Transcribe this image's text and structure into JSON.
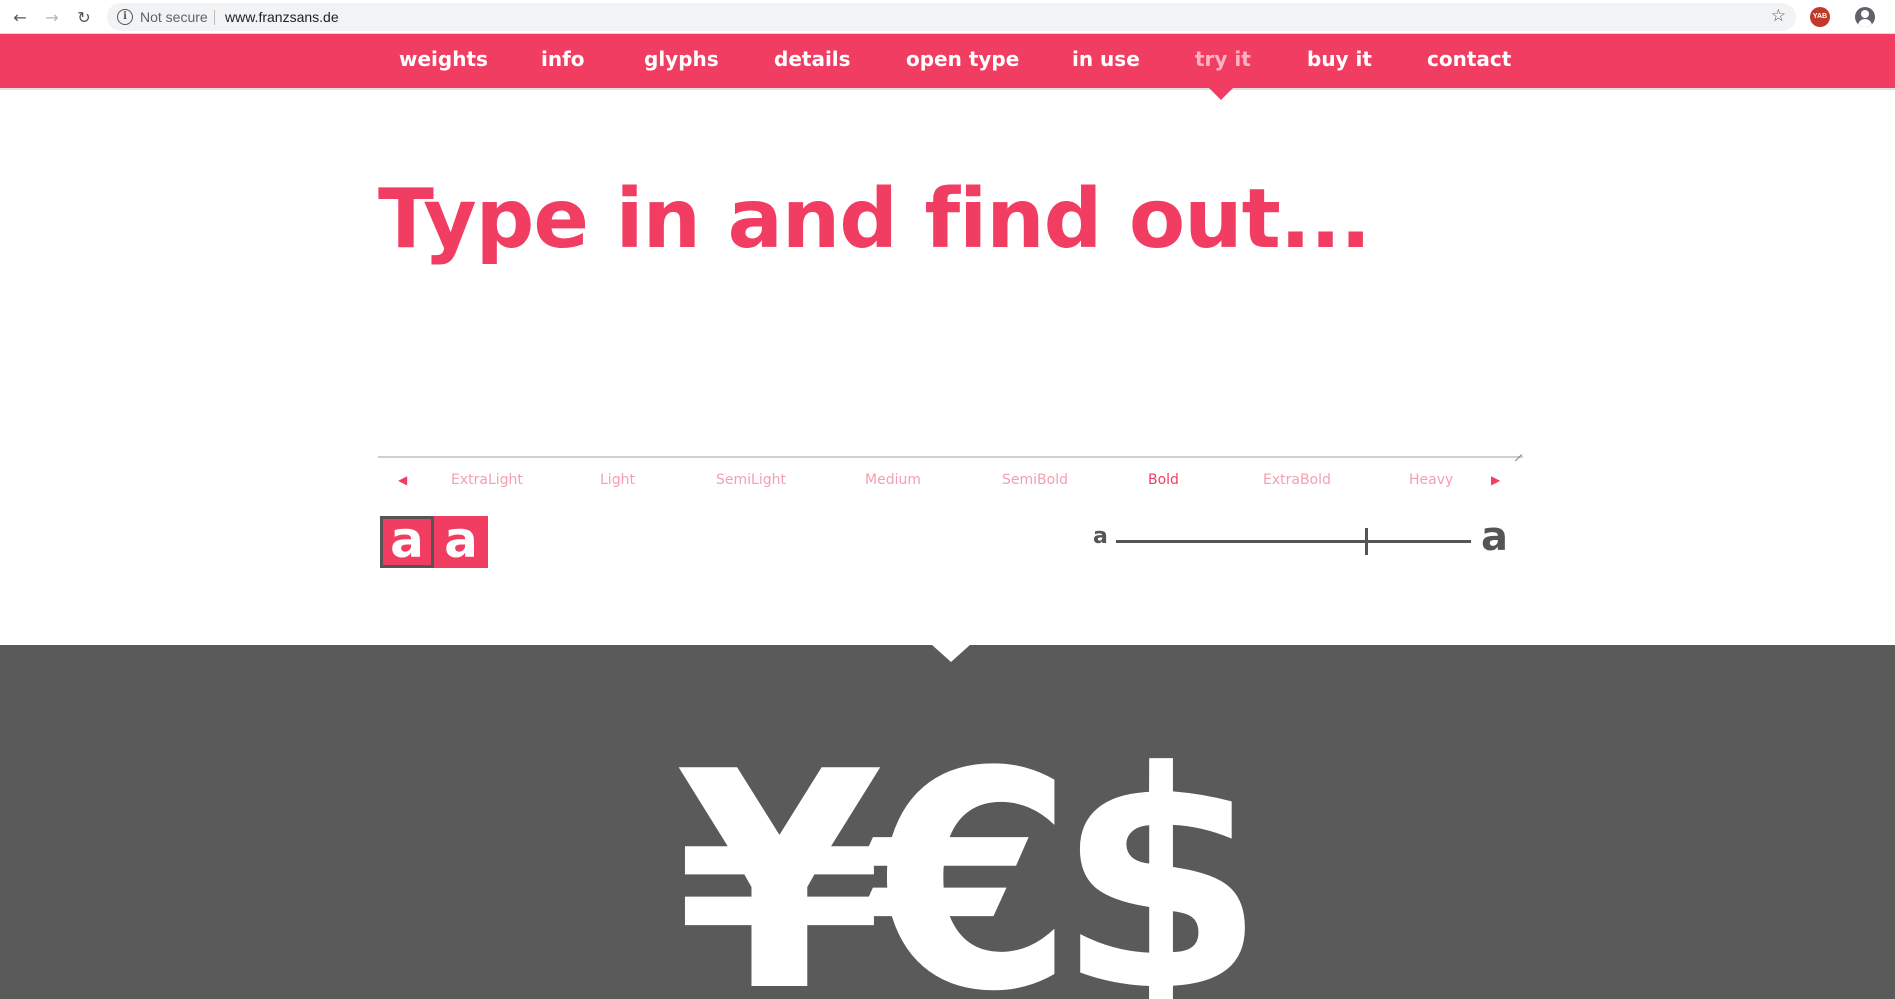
{
  "browser": {
    "security_label": "Not secure",
    "url": "www.franzsans.de",
    "extension_label": "YAB"
  },
  "nav": {
    "items": [
      {
        "label": "weights"
      },
      {
        "label": "info"
      },
      {
        "label": "glyphs"
      },
      {
        "label": "details"
      },
      {
        "label": "open type"
      },
      {
        "label": "in use"
      },
      {
        "label": "try it",
        "active": true
      },
      {
        "label": "buy it"
      },
      {
        "label": "contact"
      }
    ]
  },
  "tester": {
    "headline": "Type in and find out...",
    "weights": [
      "ExtraLight",
      "Light",
      "SemiLight",
      "Medium",
      "SemiBold",
      "Bold",
      "ExtraBold",
      "Heavy"
    ],
    "selected_weight": "Bold",
    "style_outline_glyph": "a",
    "style_filled_glyph": "a",
    "size_small_glyph": "a",
    "size_large_glyph": "a",
    "size_level": 0.7
  },
  "showcase": {
    "glyphs": "¥€$"
  },
  "colors": {
    "accent": "#f23d62",
    "accent_light": "#f4a0b1",
    "dark_panel": "#5a5a5a",
    "text_dark": "#555555"
  }
}
